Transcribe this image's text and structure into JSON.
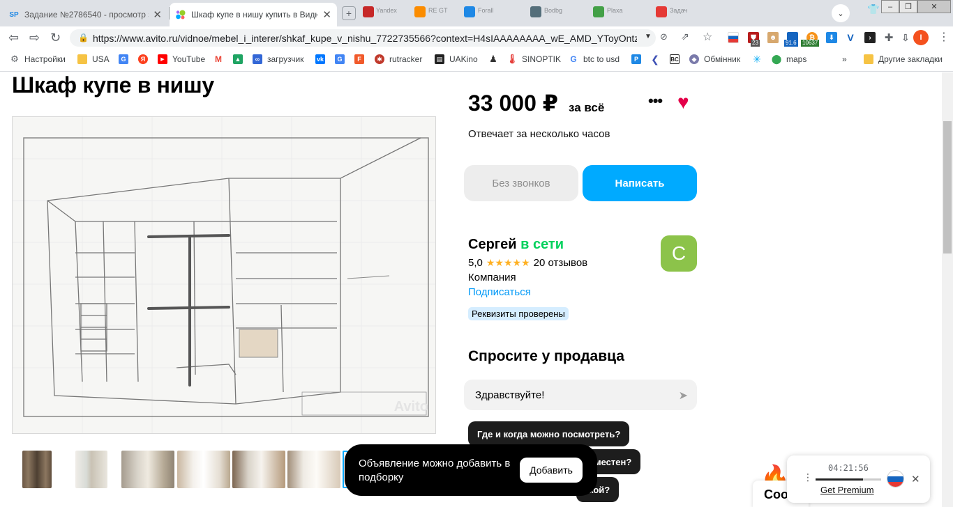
{
  "window": {
    "tabs": [
      {
        "label": "Задание №2786540 - просмотр з",
        "favicon": "SP"
      },
      {
        "label": "Шкаф купе в нишу купить в Видн",
        "favicon": "avito-icon"
      }
    ],
    "minimized_tabs": [
      "Yandex",
      "RE GT",
      "Forall",
      "Bodbg",
      "Plaxa",
      "Задач"
    ],
    "controls": {
      "minimize": "–",
      "maximize": "❐",
      "close": "✕"
    }
  },
  "toolbar": {
    "url": "https://www.avito.ru/vidnoe/mebel_i_interer/shkaf_kupe_v_nishu_7722735566?context=H4sIAAAAAAAA_wE_AMD_YToyOntzOj...",
    "extension_badges": [
      "23",
      "91.6",
      "10637"
    ],
    "profile_initial": "I"
  },
  "bookmarks": [
    {
      "label": "Настройки",
      "color": "#5f6368"
    },
    {
      "label": "USA",
      "color": "#f6c344"
    },
    {
      "label": "",
      "color": "#4285f4"
    },
    {
      "label": "",
      "color": "#fc3f1d"
    },
    {
      "label": "YouTube",
      "color": "#ff0000"
    },
    {
      "label": "",
      "color": "#ea4335"
    },
    {
      "label": "",
      "color": "#1fa463"
    },
    {
      "label": "загрузчик",
      "color": "#3367d6"
    },
    {
      "label": "",
      "color": "#0077ff"
    },
    {
      "label": "",
      "color": "#4285f4"
    },
    {
      "label": "",
      "color": "#f15a2b"
    },
    {
      "label": "rutracker",
      "color": "#c0392b"
    },
    {
      "label": "UAKino",
      "color": "#222222"
    },
    {
      "label": "",
      "color": "#333333"
    },
    {
      "label": "SINOPTIK",
      "color": "#e53935"
    },
    {
      "label": "btc to usd",
      "color": "#4285f4"
    },
    {
      "label": "",
      "color": "#1e88e5"
    },
    {
      "label": "",
      "color": "#3f51b5"
    },
    {
      "label": "",
      "color": "#333333"
    },
    {
      "label": "Обмінник",
      "color": "#7a7aaa"
    },
    {
      "label": "",
      "color": "#03a9f4"
    },
    {
      "label": "maps",
      "color": "#34a853"
    }
  ],
  "bookmarks_overflow": "»",
  "bookmarks_other": "Другие закладки",
  "listing": {
    "title": "Шкаф купе в нишу",
    "price": "33 000 ₽",
    "price_suffix": "за всё",
    "response_time": "Отвечает за несколько часов",
    "btn_no_calls": "Без звонков",
    "btn_write": "Написать",
    "watermark": "Avito"
  },
  "seller": {
    "name": "Сергей",
    "status": "в сети",
    "rating": "5,0",
    "stars": "★★★★★",
    "reviews": "20 отзывов",
    "type": "Компания",
    "subscribe": "Подписаться",
    "verified": "Реквизиты проверены",
    "avatar_letter": "С"
  },
  "ask": {
    "title": "Спросите у продавца",
    "message": "Здравствуйте!",
    "chips": [
      "Где и когда можно посмотреть?",
      "местен?",
      "кой?"
    ]
  },
  "toast": {
    "text": "Объявление можно добавить в подборку",
    "button": "Добавить"
  },
  "chat_label": "Соо",
  "vpn": {
    "time": "04:21:56",
    "link": "Get Premium",
    "progress": 0.72
  }
}
